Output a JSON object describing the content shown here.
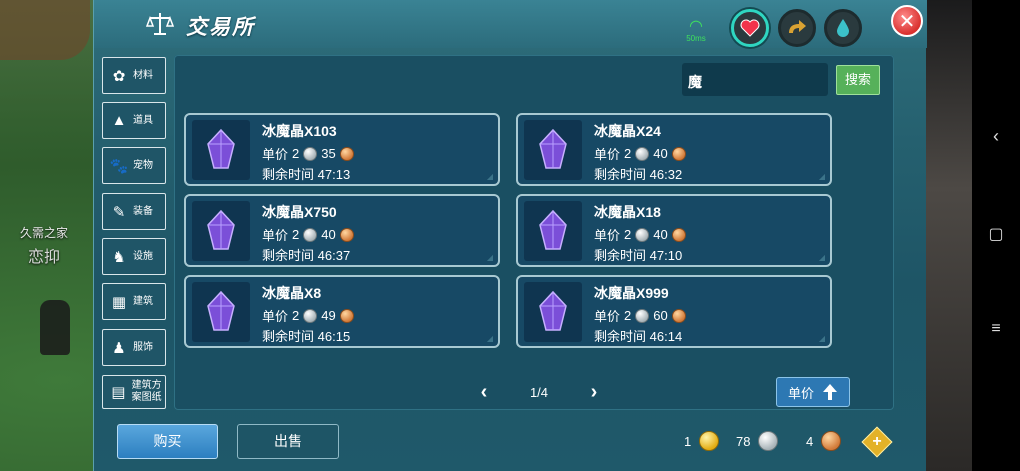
{
  "window": {
    "title": "交易所"
  },
  "player": {
    "line1": "久需之家",
    "line2": "恋抑"
  },
  "status": {
    "ping": "50ms"
  },
  "sidebar": {
    "items": [
      {
        "label": "材料",
        "icon": "materials-icon",
        "glyph": "✿"
      },
      {
        "label": "道具",
        "icon": "tool-icon",
        "glyph": "▲"
      },
      {
        "label": "宠物",
        "icon": "paw-icon",
        "glyph": "🐾"
      },
      {
        "label": "装备",
        "icon": "equipment-icon",
        "glyph": "✎"
      },
      {
        "label": "设施",
        "icon": "facility-icon",
        "glyph": "♞"
      },
      {
        "label": "建筑",
        "icon": "building-icon",
        "glyph": "▦"
      },
      {
        "label": "服饰",
        "icon": "clothing-icon",
        "glyph": "♟"
      },
      {
        "label": "建筑方案图纸",
        "icon": "blueprint-icon",
        "glyph": "▤"
      }
    ]
  },
  "search": {
    "value": "魔",
    "button_label": "搜索"
  },
  "listings": [
    {
      "name": "冰魔晶X103",
      "price_label": "单价",
      "silver": "2",
      "copper": "35",
      "time_label": "剩余时间",
      "time": "47:13"
    },
    {
      "name": "冰魔晶X24",
      "price_label": "单价",
      "silver": "2",
      "copper": "40",
      "time_label": "剩余时间",
      "time": "46:32"
    },
    {
      "name": "冰魔晶X750",
      "price_label": "单价",
      "silver": "2",
      "copper": "40",
      "time_label": "剩余时间",
      "time": "46:37"
    },
    {
      "name": "冰魔晶X18",
      "price_label": "单价",
      "silver": "2",
      "copper": "40",
      "time_label": "剩余时间",
      "time": "47:10"
    },
    {
      "name": "冰魔晶X8",
      "price_label": "单价",
      "silver": "2",
      "copper": "49",
      "time_label": "剩余时间",
      "time": "46:15"
    },
    {
      "name": "冰魔晶X999",
      "price_label": "单价",
      "silver": "2",
      "copper": "60",
      "time_label": "剩余时间",
      "time": "46:14"
    }
  ],
  "pagination": {
    "page": "1/4"
  },
  "sort": {
    "label": "单价"
  },
  "tabs": {
    "buy": "购买",
    "sell": "出售"
  },
  "wallet": {
    "gold": "1",
    "silver": "78",
    "copper": "4"
  },
  "colors": {
    "panel": "#25606f",
    "search_button": "#56b15a",
    "close_button": "#d9312f",
    "buy_tab": "#2c7fc0"
  }
}
